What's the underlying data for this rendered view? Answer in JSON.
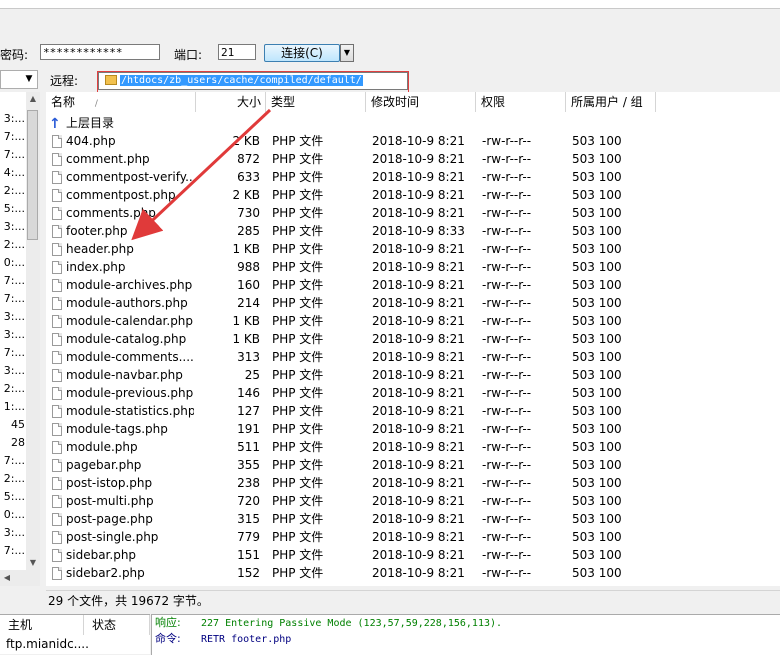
{
  "login": {
    "password_label": "密码:",
    "password_value": "************",
    "port_label": "端口:",
    "port_value": "21",
    "connect_label": "连接(C)",
    "connect_drop": "▼"
  },
  "local": {
    "path_drop": "▼",
    "rows": [
      "",
      "3:...",
      "7:...",
      "7:...",
      "4:...",
      "2:...",
      "5:...",
      "3:...",
      "2:...",
      "0:...",
      "7:...",
      "7:...",
      "3:...",
      "3:...",
      "7:...",
      "3:...",
      "2:...",
      "1:...",
      "45",
      "28",
      "7:...",
      "2:...",
      "5:...",
      "0:...",
      "3:...",
      "7:..."
    ]
  },
  "remote": {
    "label": "远程:",
    "path": "/htdocs/zb_users/cache/compiled/default/",
    "columns": {
      "name": "名称",
      "size": "大小",
      "type": "类型",
      "mtime": "修改时间",
      "perm": "权限",
      "owner": "所属用户 / 组"
    },
    "parent_dir": "上层目录",
    "files": [
      {
        "name": "404.php",
        "size": "2 KB",
        "type": "PHP 文件",
        "mtime": "2018-10-9 8:21",
        "perm": "-rw-r--r--",
        "owner": "503 100"
      },
      {
        "name": "comment.php",
        "size": "872",
        "type": "PHP 文件",
        "mtime": "2018-10-9 8:21",
        "perm": "-rw-r--r--",
        "owner": "503 100"
      },
      {
        "name": "commentpost-verify...",
        "size": "633",
        "type": "PHP 文件",
        "mtime": "2018-10-9 8:21",
        "perm": "-rw-r--r--",
        "owner": "503 100"
      },
      {
        "name": "commentpost.php",
        "size": "2 KB",
        "type": "PHP 文件",
        "mtime": "2018-10-9 8:21",
        "perm": "-rw-r--r--",
        "owner": "503 100"
      },
      {
        "name": "comments.php",
        "size": "730",
        "type": "PHP 文件",
        "mtime": "2018-10-9 8:21",
        "perm": "-rw-r--r--",
        "owner": "503 100"
      },
      {
        "name": "footer.php",
        "size": "285",
        "type": "PHP 文件",
        "mtime": "2018-10-9 8:33",
        "perm": "-rw-r--r--",
        "owner": "503 100"
      },
      {
        "name": "header.php",
        "size": "1 KB",
        "type": "PHP 文件",
        "mtime": "2018-10-9 8:21",
        "perm": "-rw-r--r--",
        "owner": "503 100"
      },
      {
        "name": "index.php",
        "size": "988",
        "type": "PHP 文件",
        "mtime": "2018-10-9 8:21",
        "perm": "-rw-r--r--",
        "owner": "503 100"
      },
      {
        "name": "module-archives.php",
        "size": "160",
        "type": "PHP 文件",
        "mtime": "2018-10-9 8:21",
        "perm": "-rw-r--r--",
        "owner": "503 100"
      },
      {
        "name": "module-authors.php",
        "size": "214",
        "type": "PHP 文件",
        "mtime": "2018-10-9 8:21",
        "perm": "-rw-r--r--",
        "owner": "503 100"
      },
      {
        "name": "module-calendar.php",
        "size": "1 KB",
        "type": "PHP 文件",
        "mtime": "2018-10-9 8:21",
        "perm": "-rw-r--r--",
        "owner": "503 100"
      },
      {
        "name": "module-catalog.php",
        "size": "1 KB",
        "type": "PHP 文件",
        "mtime": "2018-10-9 8:21",
        "perm": "-rw-r--r--",
        "owner": "503 100"
      },
      {
        "name": "module-comments....",
        "size": "313",
        "type": "PHP 文件",
        "mtime": "2018-10-9 8:21",
        "perm": "-rw-r--r--",
        "owner": "503 100"
      },
      {
        "name": "module-navbar.php",
        "size": "25",
        "type": "PHP 文件",
        "mtime": "2018-10-9 8:21",
        "perm": "-rw-r--r--",
        "owner": "503 100"
      },
      {
        "name": "module-previous.php",
        "size": "146",
        "type": "PHP 文件",
        "mtime": "2018-10-9 8:21",
        "perm": "-rw-r--r--",
        "owner": "503 100"
      },
      {
        "name": "module-statistics.php",
        "size": "127",
        "type": "PHP 文件",
        "mtime": "2018-10-9 8:21",
        "perm": "-rw-r--r--",
        "owner": "503 100"
      },
      {
        "name": "module-tags.php",
        "size": "191",
        "type": "PHP 文件",
        "mtime": "2018-10-9 8:21",
        "perm": "-rw-r--r--",
        "owner": "503 100"
      },
      {
        "name": "module.php",
        "size": "511",
        "type": "PHP 文件",
        "mtime": "2018-10-9 8:21",
        "perm": "-rw-r--r--",
        "owner": "503 100"
      },
      {
        "name": "pagebar.php",
        "size": "355",
        "type": "PHP 文件",
        "mtime": "2018-10-9 8:21",
        "perm": "-rw-r--r--",
        "owner": "503 100"
      },
      {
        "name": "post-istop.php",
        "size": "238",
        "type": "PHP 文件",
        "mtime": "2018-10-9 8:21",
        "perm": "-rw-r--r--",
        "owner": "503 100"
      },
      {
        "name": "post-multi.php",
        "size": "720",
        "type": "PHP 文件",
        "mtime": "2018-10-9 8:21",
        "perm": "-rw-r--r--",
        "owner": "503 100"
      },
      {
        "name": "post-page.php",
        "size": "315",
        "type": "PHP 文件",
        "mtime": "2018-10-9 8:21",
        "perm": "-rw-r--r--",
        "owner": "503 100"
      },
      {
        "name": "post-single.php",
        "size": "779",
        "type": "PHP 文件",
        "mtime": "2018-10-9 8:21",
        "perm": "-rw-r--r--",
        "owner": "503 100"
      },
      {
        "name": "sidebar.php",
        "size": "151",
        "type": "PHP 文件",
        "mtime": "2018-10-9 8:21",
        "perm": "-rw-r--r--",
        "owner": "503 100"
      },
      {
        "name": "sidebar2.php",
        "size": "152",
        "type": "PHP 文件",
        "mtime": "2018-10-9 8:21",
        "perm": "-rw-r--r--",
        "owner": "503 100"
      }
    ],
    "status": "29 个文件，共 19672 字节。"
  },
  "queue": {
    "col_host": "主机",
    "col_status": "状态",
    "host": "ftp.mianidc...."
  },
  "log": [
    {
      "tag": "响应:",
      "msg": "227 Entering Passive Mode (123,57,59,228,156,113).",
      "color": "#008000"
    },
    {
      "tag": "命令:",
      "msg": "RETR footer.php",
      "color": "#000080"
    }
  ],
  "colors": {
    "annotation_red": "#e03a3a",
    "selection_blue": "#3399ff"
  }
}
